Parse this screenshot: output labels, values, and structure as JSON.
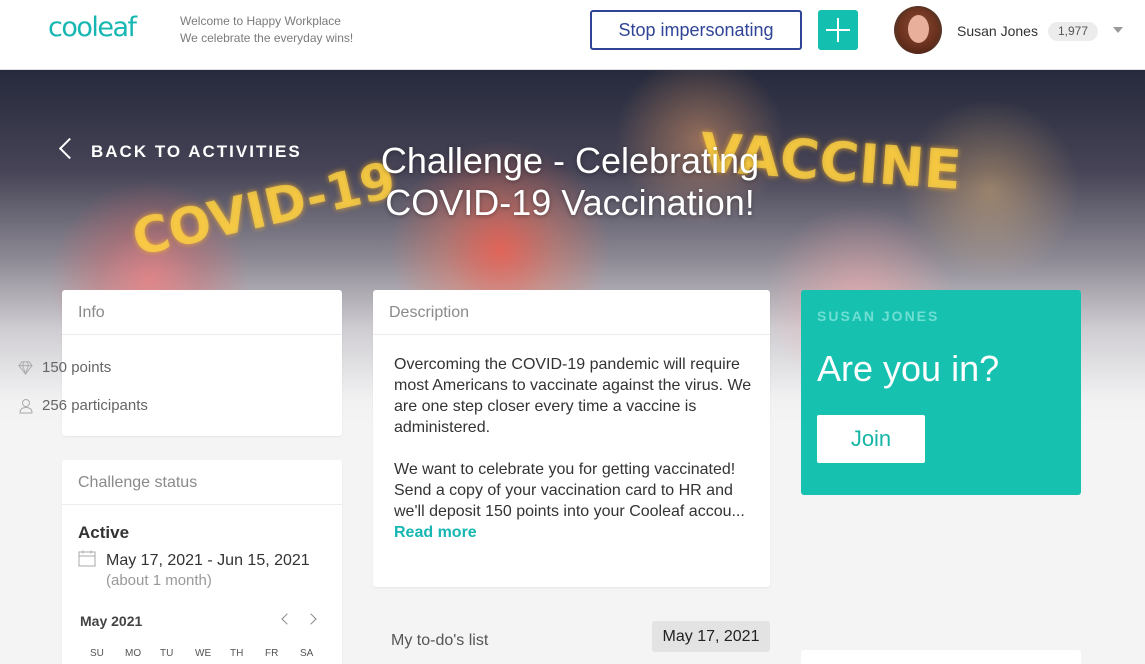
{
  "header": {
    "logo": "cooleaf",
    "tagline_line1": "Welcome to Happy Workplace",
    "tagline_line2": "We celebrate the everyday wins!",
    "stop_impersonating_label": "Stop impersonating",
    "add_icon": "plus-icon",
    "user_name": "Susan Jones",
    "user_points": "1,977",
    "menu_icon": "caret-down-icon"
  },
  "hero": {
    "back_label": "BACK TO ACTIVITIES",
    "title": "Challenge - Celebrating COVID-19 Vaccination!",
    "background_text": [
      "COVID-19",
      "VACCINE"
    ]
  },
  "info": {
    "heading": "Info",
    "points": "150 points",
    "participants": "256 participants"
  },
  "status": {
    "heading": "Challenge status",
    "state": "Active",
    "date_range": "May 17, 2021 - Jun 15, 2021",
    "duration": "(about 1 month)",
    "calendar_month": "May 2021",
    "weekdays": [
      "SU",
      "MO",
      "TU",
      "WE",
      "TH",
      "FR",
      "SA"
    ]
  },
  "description": {
    "heading": "Description",
    "paragraph1": "Overcoming the COVID-19 pandemic will require most Americans to vaccinate against the virus.  We are one step closer every time a vaccine is administered.",
    "paragraph2": "We want to celebrate you for getting vaccinated! Send a copy of your vaccination card to HR and we'll deposit 150 points into your Cooleaf accou...",
    "read_more": "Read more"
  },
  "todo": {
    "label": "My to-do's list",
    "date": "May 17, 2021"
  },
  "join": {
    "user": "SUSAN JONES",
    "question": "Are you in?",
    "button": "Join"
  },
  "colors": {
    "brand_teal": "#16b7b3",
    "join_card": "#17c1b0",
    "stop_button": "#2f4496"
  }
}
